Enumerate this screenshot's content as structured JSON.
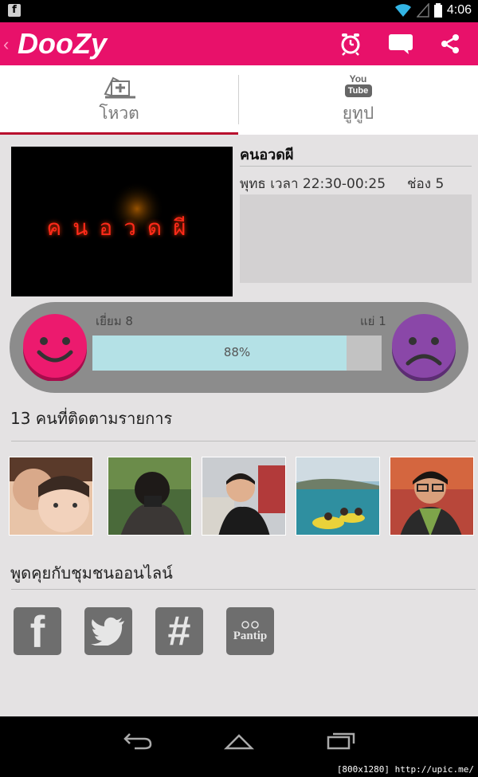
{
  "status_bar": {
    "time": "4:06",
    "left_icon": "facebook-notification-icon"
  },
  "app_bar": {
    "back_glyph": "‹",
    "logo": "DooZy",
    "actions": [
      {
        "name": "alarm-icon"
      },
      {
        "name": "chat-icon"
      },
      {
        "name": "share-icon"
      }
    ]
  },
  "tabs": [
    {
      "label": "โหวต",
      "icon": "vote-icon",
      "active": true
    },
    {
      "label": "ยูทูป",
      "icon": "youtube-icon",
      "active": false,
      "icon_text_top": "You",
      "icon_text_bottom": "Tube"
    }
  ],
  "show": {
    "poster_text": "คนอวดผี",
    "title": "คนอวดผี",
    "schedule": "พุทธ เวลา 22:30-00:25",
    "channel": "ช่อง 5"
  },
  "rating": {
    "like_label": "เยี่ยม 8",
    "dislike_label": "แย่ 1",
    "percent_label": "88%",
    "percent": 0.88,
    "like_color": "#e8116a",
    "dislike_color": "#8a47a8"
  },
  "followers": {
    "title": "13 คนที่ติดตามรายการ",
    "avatars": [
      "avatar-1",
      "avatar-2",
      "avatar-3",
      "avatar-4",
      "avatar-5"
    ]
  },
  "community": {
    "title": "พูดคุยกับชุมชนออนไลน์",
    "networks": [
      {
        "name": "facebook-icon",
        "glyph": "f"
      },
      {
        "name": "twitter-icon",
        "glyph": ""
      },
      {
        "name": "hashtag-icon",
        "glyph": "#"
      },
      {
        "name": "pantip-icon",
        "glyph": "Pantip"
      }
    ]
  },
  "watermark": "[800x1280] http://upic.me/",
  "colors": {
    "brand": "#e8116a",
    "tab_underline": "#b80e2d",
    "background": "#e4e2e3"
  }
}
